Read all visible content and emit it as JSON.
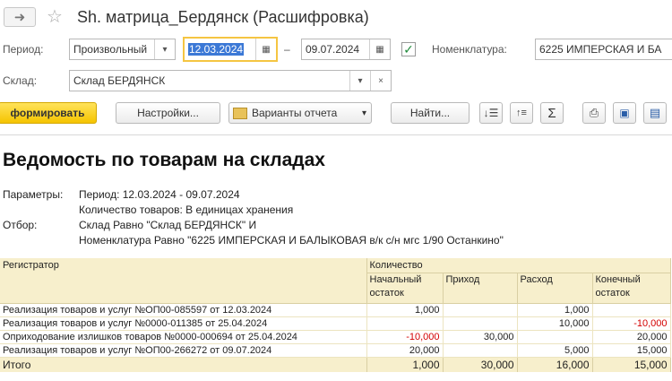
{
  "window": {
    "title": "Sh. матрица_Бердянск (Расшифровка)"
  },
  "filters": {
    "period_label": "Период:",
    "period_type": "Произвольный",
    "date_from": "12.03.2024",
    "dash": "–",
    "date_to": "09.07.2024",
    "nomenclature_label": "Номенклатура:",
    "nomenclature_value": "6225 ИМПЕРСКАЯ И БА",
    "warehouse_label": "Склад:",
    "warehouse_value": "Склад БЕРДЯНСК"
  },
  "toolbar": {
    "generate_label": "формировать",
    "settings_label": "Настройки...",
    "variants_label": "Варианты отчета",
    "find_label": "Найти..."
  },
  "report": {
    "title": "Ведомость по товарам на складах",
    "params_label": "Параметры:",
    "param_period": "Период: 12.03.2024 - 09.07.2024",
    "param_units": "Количество товаров: В единицах хранения",
    "filter_label": "Отбор:",
    "filter_line1": "Склад Равно \"Склад БЕРДЯНСК\" И",
    "filter_line2": "Номенклатура Равно \"6225 ИМПЕРСКАЯ И БАЛЫКОВАЯ в/к с/н мгс 1/90  Останкино\""
  },
  "table": {
    "col_registrar": "Регистратор",
    "col_quantity": "Количество",
    "col_start": "Начальный остаток",
    "col_in": "Приход",
    "col_out": "Расход",
    "col_end": "Конечный остаток",
    "rows": [
      {
        "doc": "Реализация товаров и услуг №ОП00-085597 от 12.03.2024",
        "start": "1,000",
        "in": "",
        "out": "1,000",
        "end": ""
      },
      {
        "doc": "Реализация товаров и услуг №0000-011385 от 25.04.2024",
        "start": "",
        "in": "",
        "out": "10,000",
        "end": "-10,000"
      },
      {
        "doc": "Оприходование излишков товаров №0000-000694 от 25.04.2024",
        "start": "-10,000",
        "in": "30,000",
        "out": "",
        "end": "20,000"
      },
      {
        "doc": "Реализация товаров и услуг №ОП00-266272 от 09.07.2024",
        "start": "20,000",
        "in": "",
        "out": "5,000",
        "end": "15,000"
      }
    ],
    "total": {
      "label": "Итого",
      "start": "1,000",
      "in": "30,000",
      "out": "16,000",
      "end": "15,000"
    }
  }
}
